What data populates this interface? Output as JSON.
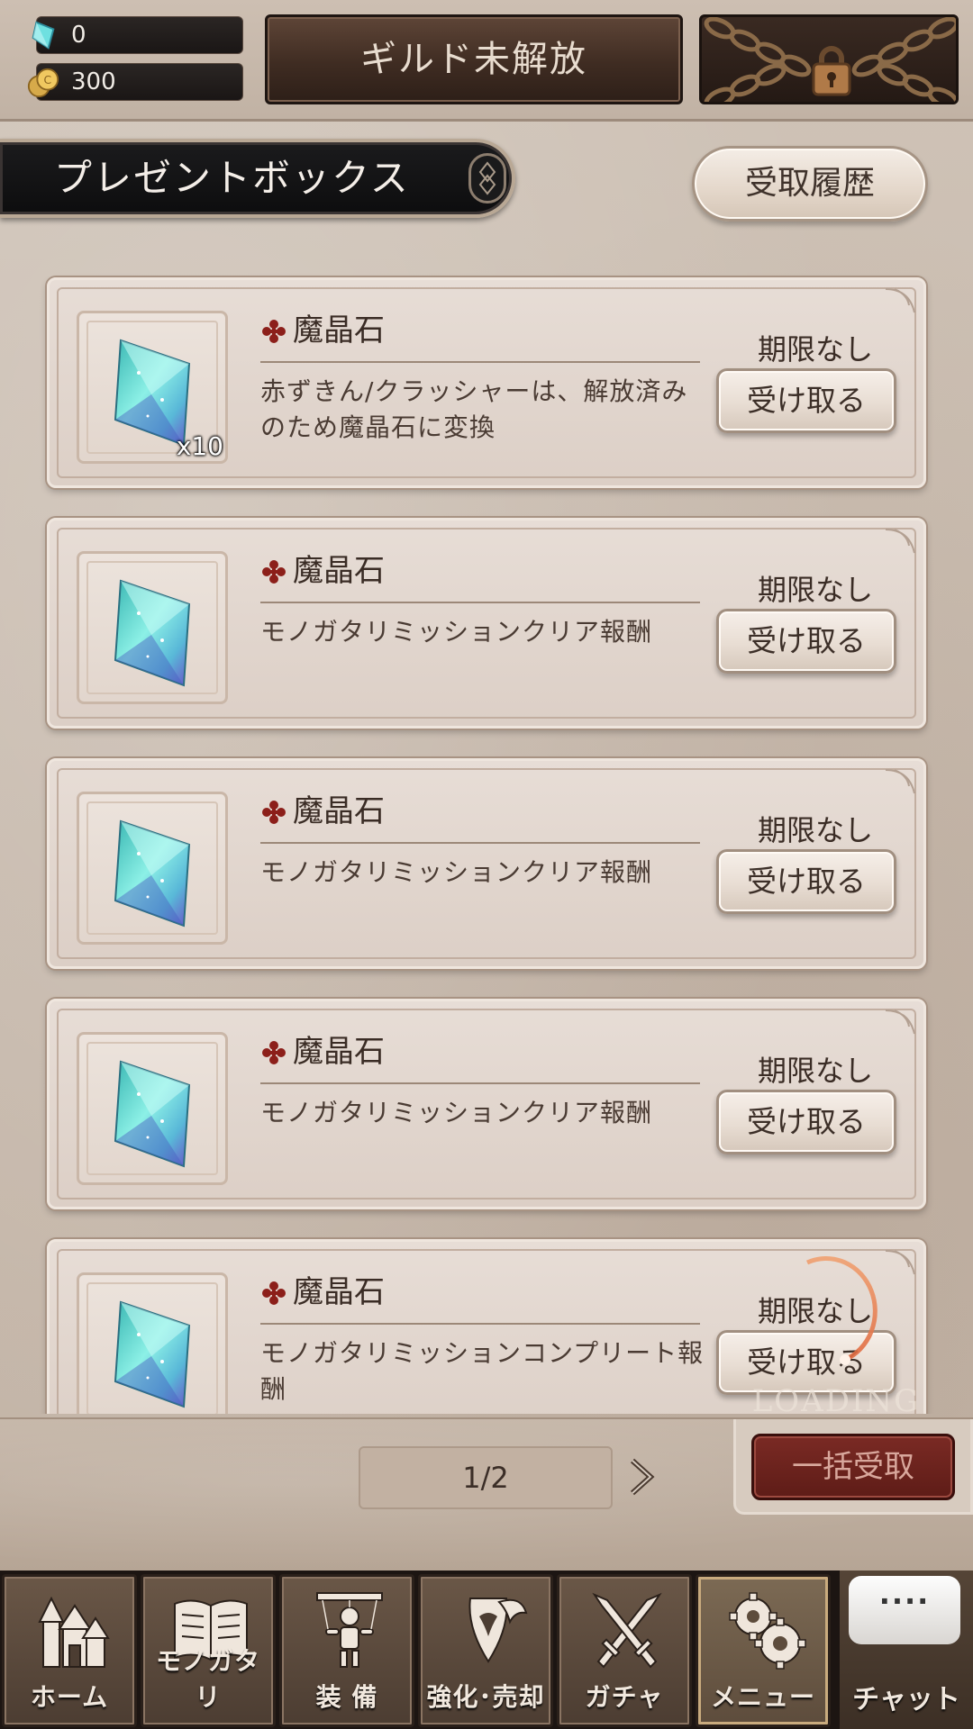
{
  "header": {
    "gems": "0",
    "coins": "300",
    "guild_label": "ギルド未解放"
  },
  "section": {
    "title": "プレゼントボックス",
    "history_label": "受取履歴"
  },
  "items": [
    {
      "name": "魔晶石",
      "description": "赤ずきん/クラッシャーは、解放済みのため魔晶石に変換",
      "quantity": "x10",
      "expiry": "期限なし",
      "button": "受け取る"
    },
    {
      "name": "魔晶石",
      "description": "モノガタリミッションクリア報酬",
      "quantity": "",
      "expiry": "期限なし",
      "button": "受け取る"
    },
    {
      "name": "魔晶石",
      "description": "モノガタリミッションクリア報酬",
      "quantity": "",
      "expiry": "期限なし",
      "button": "受け取る"
    },
    {
      "name": "魔晶石",
      "description": "モノガタリミッションクリア報酬",
      "quantity": "",
      "expiry": "期限なし",
      "button": "受け取る"
    },
    {
      "name": "魔晶石",
      "description": "モノガタリミッションコンプリート報酬",
      "quantity": "",
      "expiry": "期限なし",
      "button": "受け取る"
    }
  ],
  "loading_text": "LOADING",
  "pagination": {
    "current": "1/2"
  },
  "bulk_receive_label": "一括受取",
  "nav": {
    "home": "ホーム",
    "story": "モノガタリ",
    "equip": "装 備",
    "enhance": "強化･売却",
    "gacha": "ガチャ",
    "menu": "メニュー",
    "chat": "チャット",
    "chat_bubble": "····"
  },
  "icons": {
    "gem": "gem-icon",
    "coin": "coin-icon",
    "lock": "padlock-icon",
    "crystal": "crystal-icon",
    "mark": "quatrefoil-icon",
    "next": "chevron-right-icon"
  },
  "colors": {
    "accent_red": "#7a2a24",
    "panel_dark": "#2d1f18",
    "mark_red": "#8c1f1a"
  }
}
